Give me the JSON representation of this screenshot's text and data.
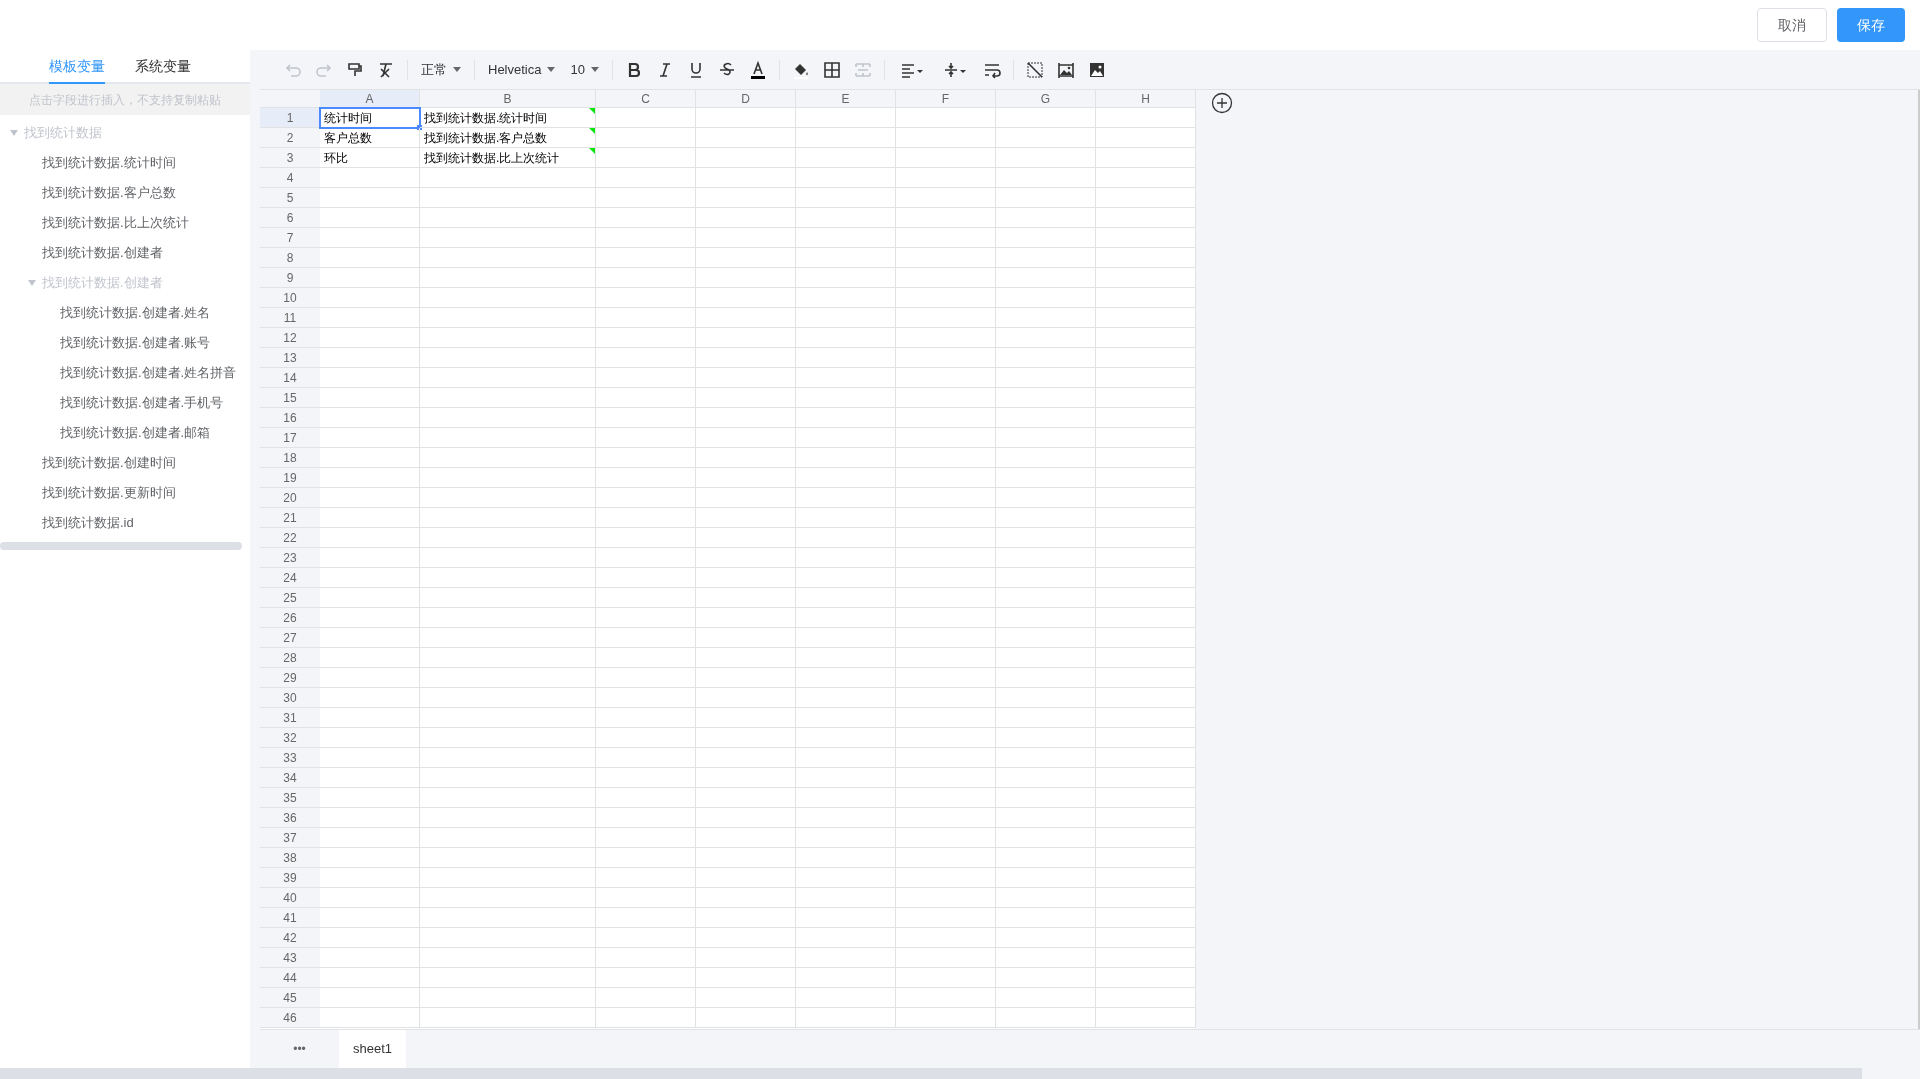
{
  "header": {
    "buttons": [
      {
        "label": "取消",
        "kind": "plain"
      },
      {
        "label": "保存",
        "kind": "primary"
      }
    ]
  },
  "sidebar": {
    "tabs": [
      {
        "label": "模板变量",
        "selected": true
      },
      {
        "label": "系统变量",
        "selected": false
      }
    ],
    "hint": "点击字段进行插入，不支持复制粘贴",
    "tree": [
      {
        "label": "找到统计数据",
        "expanded": true,
        "children": [
          {
            "label": "找到统计数据.统计时间"
          },
          {
            "label": "找到统计数据.客户总数"
          },
          {
            "label": "找到统计数据.比上次统计"
          },
          {
            "label": "找到统计数据.创建者"
          },
          {
            "label": "找到统计数据.创建者",
            "expanded": true,
            "children": [
              {
                "label": "找到统计数据.创建者.姓名"
              },
              {
                "label": "找到统计数据.创建者.账号"
              },
              {
                "label": "找到统计数据.创建者.姓名拼音"
              },
              {
                "label": "找到统计数据.创建者.手机号"
              },
              {
                "label": "找到统计数据.创建者.邮箱"
              }
            ]
          },
          {
            "label": "找到统计数据.创建时间"
          },
          {
            "label": "找到统计数据.更新时间"
          },
          {
            "label": "找到统计数据.id"
          }
        ]
      }
    ]
  },
  "toolbar": [
    {
      "kind": "undo",
      "disabled": true
    },
    {
      "kind": "redo",
      "disabled": true
    },
    {
      "kind": "painter",
      "disabled": false
    },
    {
      "kind": "clear",
      "disabled": false
    },
    {
      "kind": "separator"
    },
    {
      "kind": "dropdown",
      "label": "正常"
    },
    {
      "kind": "separator"
    },
    {
      "kind": "dropdown",
      "label": "Helvetica"
    },
    {
      "kind": "dropdown",
      "label": "10"
    },
    {
      "kind": "separator"
    },
    {
      "kind": "bold",
      "disabled": false
    },
    {
      "kind": "italic",
      "disabled": false
    },
    {
      "kind": "underline",
      "disabled": false
    },
    {
      "kind": "strike",
      "disabled": false
    },
    {
      "kind": "color",
      "disabled": false
    },
    {
      "kind": "separator"
    },
    {
      "kind": "fill",
      "disabled": false
    },
    {
      "kind": "border",
      "disabled": false
    },
    {
      "kind": "merge",
      "disabled": true
    },
    {
      "kind": "separator"
    },
    {
      "kind": "align",
      "disabled": false
    },
    {
      "kind": "valign",
      "disabled": false
    },
    {
      "kind": "wrap",
      "disabled": false
    },
    {
      "kind": "separator"
    },
    {
      "kind": "freeze",
      "disabled": false
    },
    {
      "kind": "image",
      "disabled": false
    },
    {
      "kind": "picture",
      "disabled": false
    }
  ],
  "sheet": {
    "columns": [
      {
        "label": "A",
        "selected": true
      },
      {
        "label": "B",
        "selected": false
      },
      {
        "label": "C",
        "selected": false
      },
      {
        "label": "D",
        "selected": false
      },
      {
        "label": "E",
        "selected": false
      },
      {
        "label": "F",
        "selected": false
      },
      {
        "label": "G",
        "selected": false
      },
      {
        "label": "H",
        "selected": false
      }
    ],
    "rows": [
      {
        "number": "1",
        "selected": true,
        "cells": [
          {
            "text": "统计时间",
            "selected": true,
            "flagged": false
          },
          {
            "text": "找到统计数据.统计时间",
            "selected": false,
            "flagged": true
          }
        ]
      },
      {
        "number": "2",
        "selected": false,
        "cells": [
          {
            "text": "客户总数",
            "selected": false,
            "flagged": false
          },
          {
            "text": "找到统计数据.客户总数",
            "selected": false,
            "flagged": true
          }
        ]
      },
      {
        "number": "3",
        "selected": false,
        "cells": [
          {
            "text": "环比",
            "selected": false,
            "flagged": false
          },
          {
            "text": "找到统计数据.比上次统计",
            "selected": false,
            "flagged": true
          }
        ]
      },
      {
        "number": "4",
        "selected": false
      },
      {
        "number": "5",
        "selected": false
      },
      {
        "number": "6",
        "selected": false
      },
      {
        "number": "7",
        "selected": false
      },
      {
        "number": "8",
        "selected": false
      },
      {
        "number": "9",
        "selected": false
      },
      {
        "number": "10",
        "selected": false
      },
      {
        "number": "11",
        "selected": false
      },
      {
        "number": "12",
        "selected": false
      },
      {
        "number": "13",
        "selected": false
      },
      {
        "number": "14",
        "selected": false
      },
      {
        "number": "15",
        "selected": false
      },
      {
        "number": "16",
        "selected": false
      },
      {
        "number": "17",
        "selected": false
      },
      {
        "number": "18",
        "selected": false
      },
      {
        "number": "19",
        "selected": false
      },
      {
        "number": "20",
        "selected": false
      },
      {
        "number": "21",
        "selected": false
      },
      {
        "number": "22",
        "selected": false
      },
      {
        "number": "23",
        "selected": false
      },
      {
        "number": "24",
        "selected": false
      },
      {
        "number": "25",
        "selected": false
      },
      {
        "number": "26",
        "selected": false
      },
      {
        "number": "27",
        "selected": false
      },
      {
        "number": "28",
        "selected": false
      },
      {
        "number": "29",
        "selected": false
      },
      {
        "number": "30",
        "selected": false
      },
      {
        "number": "31",
        "selected": false
      },
      {
        "number": "32",
        "selected": false
      },
      {
        "number": "33",
        "selected": false
      },
      {
        "number": "34",
        "selected": false
      },
      {
        "number": "35",
        "selected": false
      },
      {
        "number": "36",
        "selected": false
      },
      {
        "number": "37",
        "selected": false
      },
      {
        "number": "38",
        "selected": false
      },
      {
        "number": "39",
        "selected": false
      },
      {
        "number": "40",
        "selected": false
      },
      {
        "number": "41",
        "selected": false
      },
      {
        "number": "42",
        "selected": false
      },
      {
        "number": "43",
        "selected": false
      },
      {
        "number": "44",
        "selected": false
      },
      {
        "number": "45",
        "selected": false
      },
      {
        "number": "46",
        "selected": false
      }
    ]
  },
  "sheet_tabs": {
    "menu": "•••",
    "tabs": [
      {
        "label": "sheet1",
        "selected": true
      }
    ]
  }
}
